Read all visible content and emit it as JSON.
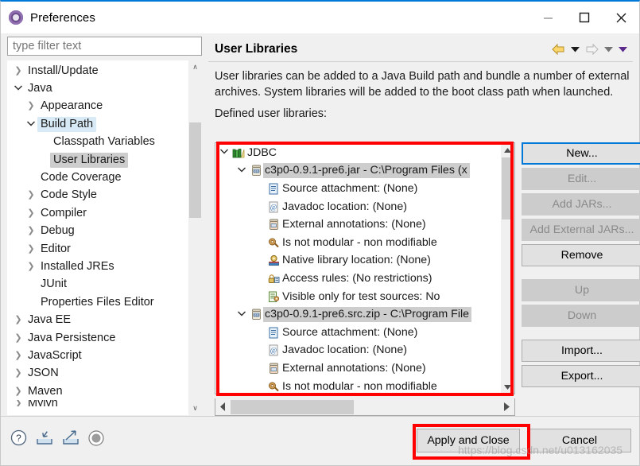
{
  "window": {
    "title": "Preferences",
    "icon": "preferences-gear-icon",
    "controls": {
      "minimize": "—",
      "maximize": "□",
      "close": "✕"
    }
  },
  "sidebar": {
    "filter_placeholder": "type filter text",
    "filter_value": "",
    "items": [
      {
        "label": "Install/Update",
        "indent": 0,
        "arrow": "collapsed",
        "state": "normal"
      },
      {
        "label": "Java",
        "indent": 0,
        "arrow": "expanded",
        "state": "normal"
      },
      {
        "label": "Appearance",
        "indent": 1,
        "arrow": "collapsed",
        "state": "normal"
      },
      {
        "label": "Build Path",
        "indent": 1,
        "arrow": "expanded",
        "state": "selected-blue"
      },
      {
        "label": "Classpath Variables",
        "indent": 2,
        "arrow": "none",
        "state": "normal"
      },
      {
        "label": "User Libraries",
        "indent": 2,
        "arrow": "none",
        "state": "selected-gray"
      },
      {
        "label": "Code Coverage",
        "indent": 1,
        "arrow": "none",
        "state": "normal"
      },
      {
        "label": "Code Style",
        "indent": 1,
        "arrow": "collapsed",
        "state": "normal"
      },
      {
        "label": "Compiler",
        "indent": 1,
        "arrow": "collapsed",
        "state": "normal"
      },
      {
        "label": "Debug",
        "indent": 1,
        "arrow": "collapsed",
        "state": "normal"
      },
      {
        "label": "Editor",
        "indent": 1,
        "arrow": "collapsed",
        "state": "normal"
      },
      {
        "label": "Installed JREs",
        "indent": 1,
        "arrow": "collapsed",
        "state": "normal"
      },
      {
        "label": "JUnit",
        "indent": 1,
        "arrow": "none",
        "state": "normal"
      },
      {
        "label": "Properties Files Editor",
        "indent": 1,
        "arrow": "none",
        "state": "normal"
      },
      {
        "label": "Java EE",
        "indent": 0,
        "arrow": "collapsed",
        "state": "normal"
      },
      {
        "label": "Java Persistence",
        "indent": 0,
        "arrow": "collapsed",
        "state": "normal"
      },
      {
        "label": "JavaScript",
        "indent": 0,
        "arrow": "collapsed",
        "state": "normal"
      },
      {
        "label": "JSON",
        "indent": 0,
        "arrow": "collapsed",
        "state": "normal"
      },
      {
        "label": "Maven",
        "indent": 0,
        "arrow": "collapsed",
        "state": "normal"
      }
    ],
    "scrollbar": {
      "up": "∧",
      "down": "∨"
    }
  },
  "page": {
    "title": "User Libraries",
    "nav": {
      "back_icon": "back-arrow-icon",
      "back_menu_icon": "chevron-down-icon",
      "forward_icon": "forward-arrow-icon",
      "forward_menu_icon": "chevron-down-icon",
      "view_menu_icon": "chevron-down-icon"
    },
    "description": "User libraries can be added to a Java Build path and bundle a number of external archives. System libraries will be added to the boot class path when launched.",
    "defined_label": "Defined user libraries:"
  },
  "library_tree": [
    {
      "label": "JDBC",
      "icon": "library-books-icon",
      "indent": 1,
      "arrow": "expanded",
      "selected": false
    },
    {
      "label": "c3p0-0.9.1-pre6.jar - C:\\Program Files (x",
      "icon": "jar-icon",
      "indent": 2,
      "arrow": "expanded",
      "selected": true
    },
    {
      "label": "Source attachment: (None)",
      "icon": "source-attachment-icon",
      "indent": 3,
      "arrow": "none",
      "selected": false
    },
    {
      "label": "Javadoc location: (None)",
      "icon": "javadoc-icon",
      "indent": 3,
      "arrow": "none",
      "selected": false
    },
    {
      "label": "External annotations: (None)",
      "icon": "external-annotations-icon",
      "indent": 3,
      "arrow": "none",
      "selected": false
    },
    {
      "label": "Is not modular - non modifiable",
      "icon": "module-icon",
      "indent": 3,
      "arrow": "none",
      "selected": false
    },
    {
      "label": "Native library location: (None)",
      "icon": "native-library-icon",
      "indent": 3,
      "arrow": "none",
      "selected": false
    },
    {
      "label": "Access rules: (No restrictions)",
      "icon": "access-rules-lock-icon",
      "indent": 3,
      "arrow": "none",
      "selected": false
    },
    {
      "label": "Visible only for test sources: No",
      "icon": "test-sources-icon",
      "indent": 3,
      "arrow": "none",
      "selected": false
    },
    {
      "label": "c3p0-0.9.1-pre6.src.zip - C:\\Program File",
      "icon": "jar-icon",
      "indent": 2,
      "arrow": "expanded",
      "selected": true
    },
    {
      "label": "Source attachment: (None)",
      "icon": "source-attachment-icon",
      "indent": 3,
      "arrow": "none",
      "selected": false
    },
    {
      "label": "Javadoc location: (None)",
      "icon": "javadoc-icon",
      "indent": 3,
      "arrow": "none",
      "selected": false
    },
    {
      "label": "External annotations: (None)",
      "icon": "external-annotations-icon",
      "indent": 3,
      "arrow": "none",
      "selected": false
    },
    {
      "label": "Is not modular - non modifiable",
      "icon": "module-icon",
      "indent": 3,
      "arrow": "none",
      "selected": false
    }
  ],
  "side_buttons": [
    {
      "label": "New...",
      "state": "focused"
    },
    {
      "label": "Edit...",
      "state": "disabled"
    },
    {
      "label": "Add JARs...",
      "state": "disabled"
    },
    {
      "label": "Add External JARs...",
      "state": "disabled"
    },
    {
      "label": "Remove",
      "state": "enabled"
    },
    {
      "label": "Up",
      "state": "disabled",
      "gap_before": true
    },
    {
      "label": "Down",
      "state": "disabled"
    },
    {
      "label": "Import...",
      "state": "enabled",
      "gap_before": true
    },
    {
      "label": "Export...",
      "state": "enabled"
    }
  ],
  "bottom": {
    "icons": [
      {
        "name": "help-icon"
      },
      {
        "name": "import-preferences-icon"
      },
      {
        "name": "export-preferences-icon"
      },
      {
        "name": "sphere-icon"
      }
    ],
    "apply_label": "Apply and Close",
    "cancel_label": "Cancel"
  },
  "watermark": "https://blog.csdn.net/u013162035",
  "colors": {
    "accent": "#0078d7",
    "annotation": "#fe0000",
    "selection_blue": "#d9eaf7",
    "selection_gray": "#cdcdcd",
    "window_bg": "#f0f0f0"
  }
}
